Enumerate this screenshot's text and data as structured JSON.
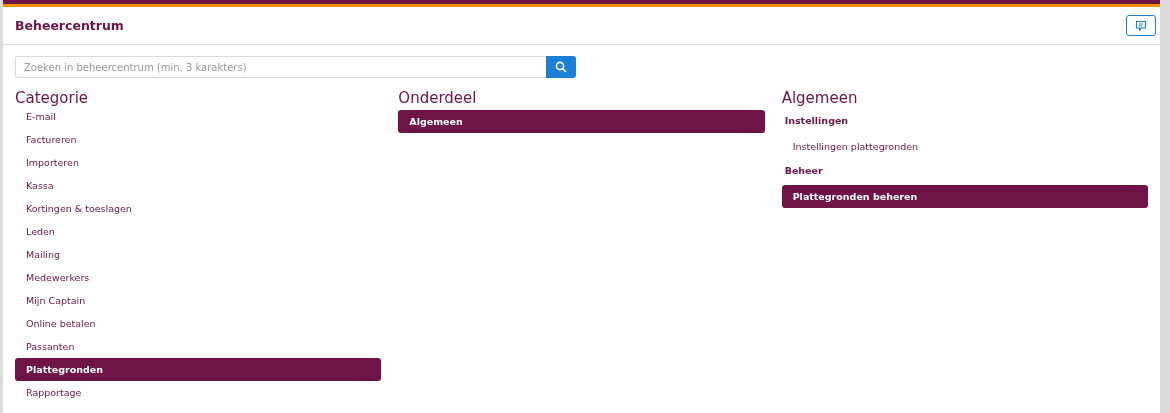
{
  "header": {
    "title": "Beheercentrum"
  },
  "search": {
    "placeholder": "Zoeken in beheercentrum (min. 3 karakters)"
  },
  "categories": {
    "title": "Categorie",
    "items": [
      {
        "label": "E-mail",
        "selected": false
      },
      {
        "label": "Factureren",
        "selected": false
      },
      {
        "label": "Importeren",
        "selected": false
      },
      {
        "label": "Kassa",
        "selected": false
      },
      {
        "label": "Kortingen & toeslagen",
        "selected": false
      },
      {
        "label": "Leden",
        "selected": false
      },
      {
        "label": "Mailing",
        "selected": false
      },
      {
        "label": "Medewerkers",
        "selected": false
      },
      {
        "label": "Mijn Captain",
        "selected": false
      },
      {
        "label": "Online betalen",
        "selected": false
      },
      {
        "label": "Passanten",
        "selected": false
      },
      {
        "label": "Plattegronden",
        "selected": true
      },
      {
        "label": "Rapportage",
        "selected": false
      }
    ]
  },
  "sections": {
    "title": "Onderdeel",
    "items": [
      {
        "label": "Algemeen",
        "selected": true
      }
    ]
  },
  "detail": {
    "title": "Algemeen",
    "groups": [
      {
        "heading": "Instellingen",
        "items": [
          {
            "label": "Instellingen plattegronden",
            "selected": false
          }
        ]
      },
      {
        "heading": "Beheer",
        "items": [
          {
            "label": "Plattegronden beheren",
            "selected": true
          }
        ]
      }
    ]
  }
}
